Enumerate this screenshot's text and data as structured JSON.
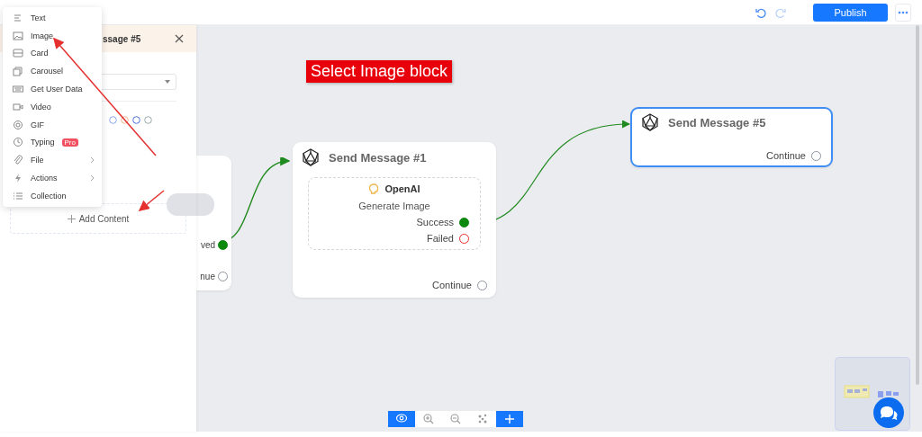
{
  "top_bar": {
    "publish": "Publish"
  },
  "panel": {
    "title": "ssage #5",
    "add_content": "Add Content"
  },
  "menu": {
    "items": [
      {
        "label": "Text",
        "kind": "text",
        "submenu": false
      },
      {
        "label": "Image",
        "kind": "image",
        "submenu": false
      },
      {
        "label": "Card",
        "kind": "card",
        "submenu": false
      },
      {
        "label": "Carousel",
        "kind": "carousel",
        "submenu": false
      },
      {
        "label": "Get User Data",
        "kind": "keyboard",
        "submenu": false
      },
      {
        "label": "Video",
        "kind": "video",
        "submenu": false
      },
      {
        "label": "GIF",
        "kind": "gif",
        "submenu": false
      },
      {
        "label": "Typing",
        "kind": "clock",
        "submenu": false,
        "badge": "Pro"
      },
      {
        "label": "File",
        "kind": "clip",
        "submenu": true
      },
      {
        "label": "Actions",
        "kind": "bolt",
        "submenu": true
      },
      {
        "label": "Collection",
        "kind": "list",
        "submenu": false
      }
    ]
  },
  "annotation": "Select Image block",
  "nodes": [
    {
      "kind": "partial",
      "selected": false,
      "outputs": [
        {
          "label": "ved",
          "connected": true
        },
        {
          "label": "nue",
          "connected": false
        }
      ]
    },
    {
      "kind": "full",
      "title": "Send Message #1",
      "selected": false,
      "block": {
        "provider": "OpenAI",
        "action": "Generate Image",
        "outputs": [
          {
            "label": "Success",
            "kind": "success"
          },
          {
            "label": "Failed",
            "kind": "failed"
          }
        ]
      },
      "outputs": [
        {
          "label": "Continue",
          "connected": false
        }
      ]
    },
    {
      "kind": "full",
      "title": "Send Message #5",
      "selected": true,
      "outputs": [
        {
          "label": "Continue",
          "connected": false
        }
      ]
    }
  ]
}
